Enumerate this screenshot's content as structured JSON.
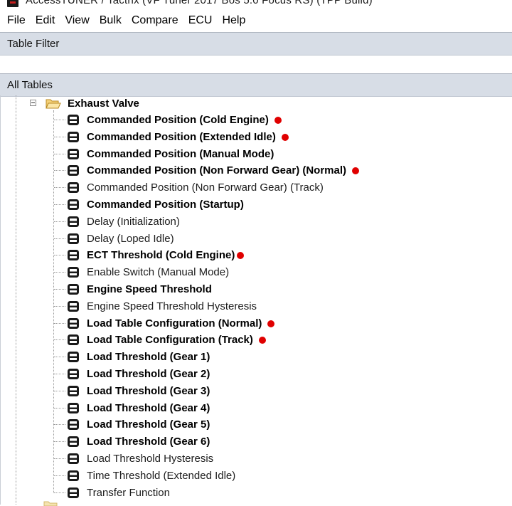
{
  "window": {
    "title": "AccessTUNER / Tactrix  (VF Tuner 2017 Bos 5.0 Focus RS)  (TPP Build)"
  },
  "menu": [
    "File",
    "Edit",
    "View",
    "Bulk",
    "Compare",
    "ECU",
    "Help"
  ],
  "table_filter": {
    "label": "Table Filter",
    "value": ""
  },
  "all_tables": {
    "label": "All Tables"
  },
  "group": {
    "label": "Exhaust Valve"
  },
  "colors": {
    "marker": "#e00000",
    "header_bg": "#d7dde6",
    "icon": "#1a1a1a"
  },
  "items": [
    {
      "label": "Commanded Position (Cold Engine)",
      "bold": true,
      "marked": true
    },
    {
      "label": "Commanded Position (Extended Idle)",
      "bold": true,
      "marked": true
    },
    {
      "label": "Commanded Position (Manual Mode)",
      "bold": true,
      "marked": false
    },
    {
      "label": "Commanded Position (Non Forward Gear) (Normal)",
      "bold": true,
      "marked": true
    },
    {
      "label": "Commanded Position (Non Forward Gear) (Track)",
      "bold": false,
      "marked": false
    },
    {
      "label": "Commanded Position (Startup)",
      "bold": true,
      "marked": false
    },
    {
      "label": "Delay (Initialization)",
      "bold": false,
      "marked": false
    },
    {
      "label": "Delay (Loped Idle)",
      "bold": false,
      "marked": false
    },
    {
      "label": "ECT Threshold (Cold Engine)",
      "bold": true,
      "marked": true
    },
    {
      "label": "Enable Switch (Manual Mode)",
      "bold": false,
      "marked": false
    },
    {
      "label": "Engine Speed Threshold",
      "bold": true,
      "marked": false
    },
    {
      "label": "Engine Speed Threshold Hysteresis",
      "bold": false,
      "marked": false
    },
    {
      "label": "Load Table Configuration (Normal)",
      "bold": true,
      "marked": true
    },
    {
      "label": "Load Table Configuration (Track)",
      "bold": true,
      "marked": true
    },
    {
      "label": "Load Threshold (Gear 1)",
      "bold": true,
      "marked": false
    },
    {
      "label": "Load Threshold (Gear 2)",
      "bold": true,
      "marked": false
    },
    {
      "label": "Load Threshold (Gear 3)",
      "bold": true,
      "marked": false
    },
    {
      "label": "Load Threshold (Gear 4)",
      "bold": true,
      "marked": false
    },
    {
      "label": "Load Threshold (Gear 5)",
      "bold": true,
      "marked": false
    },
    {
      "label": "Load Threshold (Gear 6)",
      "bold": true,
      "marked": false
    },
    {
      "label": "Load Threshold Hysteresis",
      "bold": false,
      "marked": false
    },
    {
      "label": "Time Threshold (Extended Idle)",
      "bold": false,
      "marked": false
    },
    {
      "label": "Transfer Function",
      "bold": false,
      "marked": false
    }
  ]
}
